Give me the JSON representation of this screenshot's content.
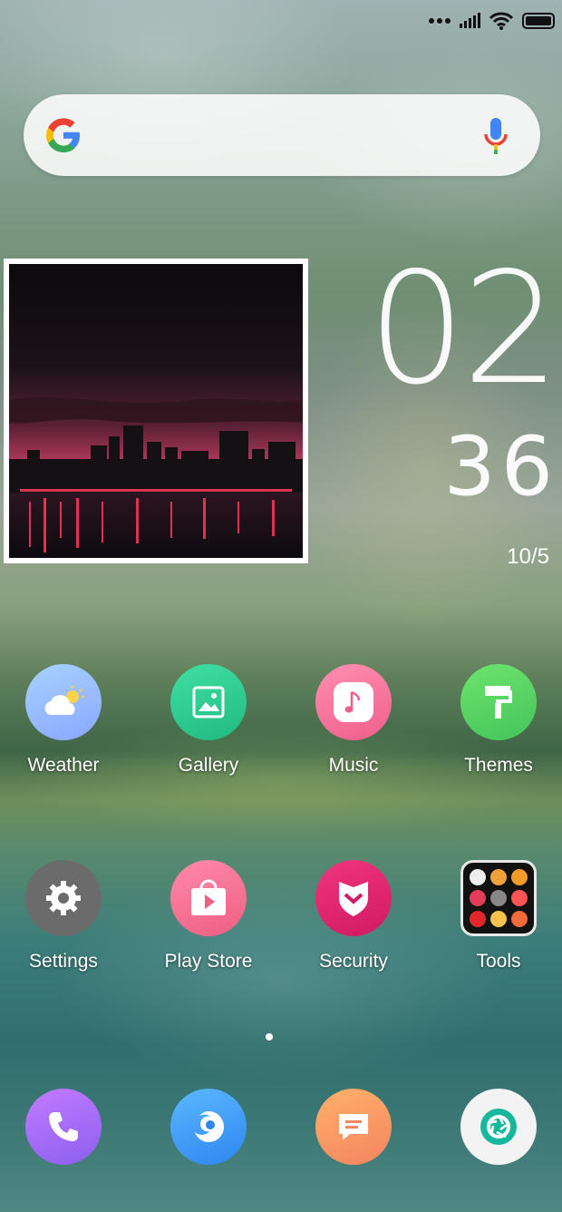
{
  "status_bar": {
    "icons": [
      "dots-icon",
      "signal-icon",
      "wifi-icon",
      "battery-icon"
    ]
  },
  "search": {
    "icons": [
      "google-logo-icon",
      "mic-icon"
    ]
  },
  "clock": {
    "hours": "02",
    "minutes": "36",
    "date": "10/5"
  },
  "apps": [
    {
      "label": "Weather",
      "icon": "weather-icon",
      "color": "#9ec2ff"
    },
    {
      "label": "Gallery",
      "icon": "gallery-icon",
      "color": "#35cf93"
    },
    {
      "label": "Music",
      "icon": "music-icon",
      "color": "#f56f9a"
    },
    {
      "label": "Themes",
      "icon": "themes-icon",
      "color": "#5fd45f"
    },
    {
      "label": "Settings",
      "icon": "gear-icon",
      "color": "#6b6b6b"
    },
    {
      "label": "Play Store",
      "icon": "play-store-icon",
      "color": "#f06b8f"
    },
    {
      "label": "Security",
      "icon": "security-icon",
      "color": "#e0246f"
    },
    {
      "label": "Tools",
      "icon": "tools-folder-icon",
      "color": "#111111"
    }
  ],
  "dock": [
    {
      "icon": "phone-icon",
      "color": "#9b6bf0"
    },
    {
      "icon": "browser-icon",
      "color": "#3fa2f5"
    },
    {
      "icon": "messages-icon",
      "color": "#f7a26a"
    },
    {
      "icon": "camera-icon",
      "color": "#f2f2f2"
    }
  ]
}
